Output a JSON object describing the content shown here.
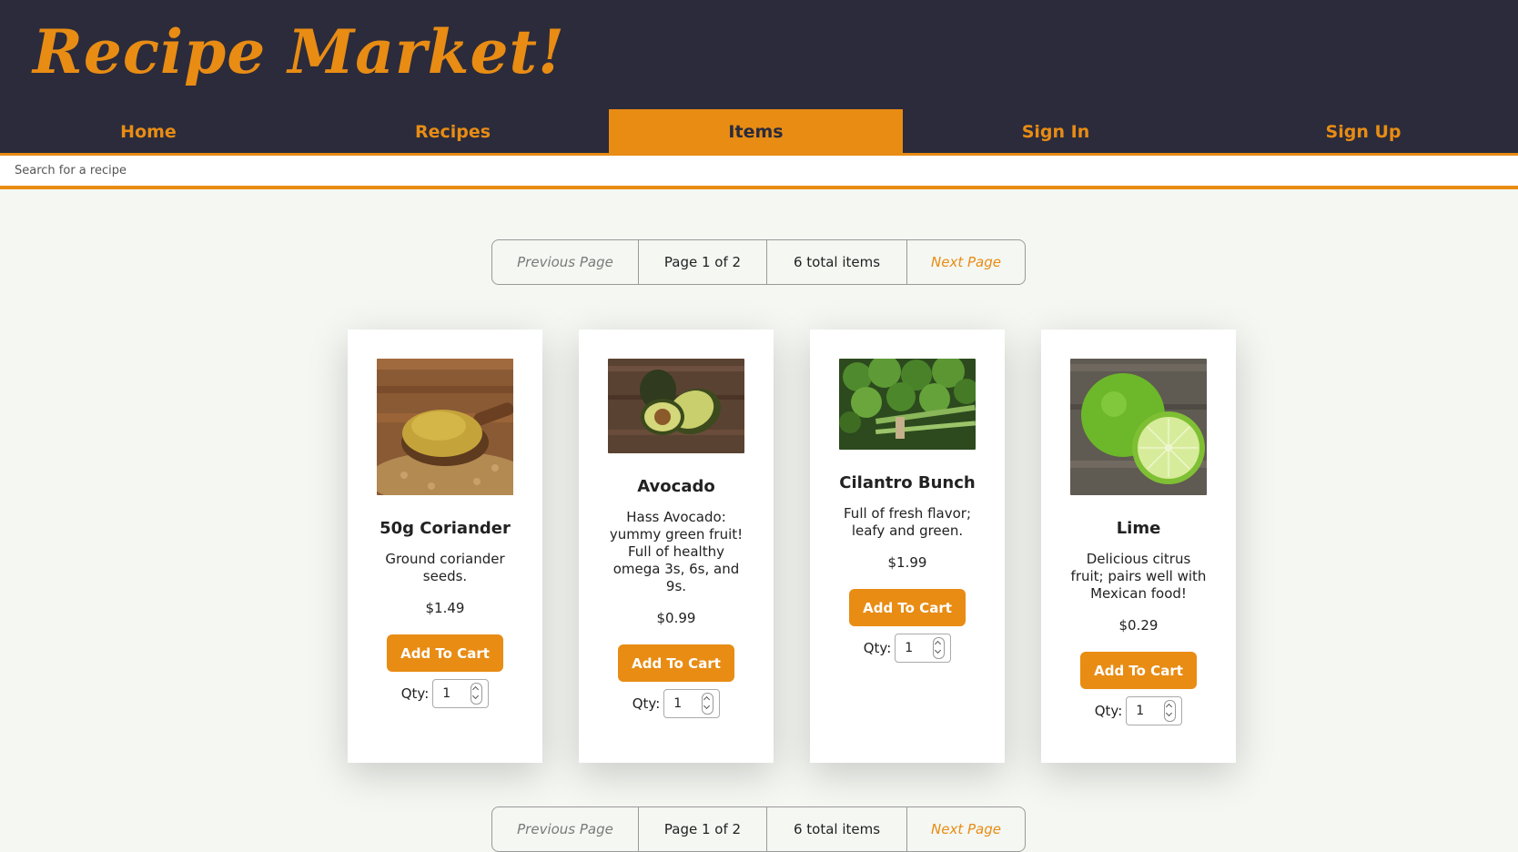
{
  "app": {
    "title": "Recipe Market!"
  },
  "nav": {
    "items": [
      {
        "label": "Home"
      },
      {
        "label": "Recipes"
      },
      {
        "label": "Items",
        "active": true
      },
      {
        "label": "Sign In"
      },
      {
        "label": "Sign Up"
      }
    ]
  },
  "search": {
    "placeholder": "Search for a recipe"
  },
  "pagination": {
    "prev": "Previous Page",
    "info": "Page 1 of 2",
    "total": "6 total items",
    "next": "Next Page"
  },
  "products": [
    {
      "name": "50g Coriander",
      "description": "Ground coriander seeds.",
      "price": "$1.49",
      "button": "Add To Cart",
      "qty_label": "Qty:",
      "qty": "1"
    },
    {
      "name": "Avocado",
      "description": "Hass Avocado: yummy green fruit! Full of healthy omega 3s, 6s, and 9s.",
      "price": "$0.99",
      "button": "Add To Cart",
      "qty_label": "Qty:",
      "qty": "1"
    },
    {
      "name": "Cilantro Bunch",
      "description": "Full of fresh flavor; leafy and green.",
      "price": "$1.99",
      "button": "Add To Cart",
      "qty_label": "Qty:",
      "qty": "1"
    },
    {
      "name": "Lime",
      "description": "Delicious citrus fruit; pairs well with Mexican food!",
      "price": "$0.29",
      "button": "Add To Cart",
      "qty_label": "Qty:",
      "qty": "1"
    }
  ],
  "colors": {
    "accent": "#e88c14",
    "header": "#2b2b3b",
    "page": "#f4f7f2"
  }
}
